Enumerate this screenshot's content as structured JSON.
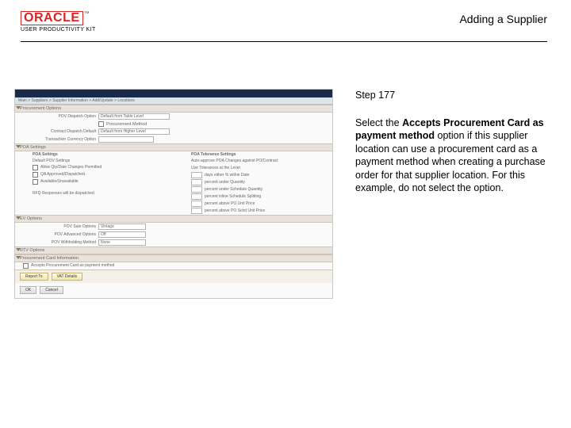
{
  "header": {
    "logo_main": "ORACLE",
    "logo_tm": "™",
    "logo_sub": "USER PRODUCTIVITY KIT",
    "title": "Adding a Supplier"
  },
  "right": {
    "step": "Step 177",
    "instr_pre": "Select the ",
    "instr_bold": "Accepts Procurement Card as payment method",
    "instr_post": " option if this supplier location can use a procurement card as a payment method when creating a purchase order for that supplier location. For this example, do not select the option."
  },
  "shot": {
    "bc": " Main  >  Suppliers  >  Supplier Information  >  Add/Update  >  Locations",
    "sect_proc": "Procurement Options",
    "row_dispatch_lbl": "POV Dispatch Option",
    "row_dispatch_val": "Default from Table Level",
    "row_procauto_cb": "□",
    "row_procauto_lbl": "Procurement Method",
    "row_contract_lbl": "Contract Dispatch Default",
    "row_contract_val": "Default from Higher Level",
    "row_curr_lbl": "Transaction Currency Option",
    "sect_poa": "POA Settings",
    "col1_head": "POA Settings",
    "col2_head": "POA Tolerance Settings",
    "col2_sub1": "Auto-approve POA Changes against PO/Contract",
    "col2_sub2": "Use Tolerances at the Level",
    "col1_sub": "Default POV Settings",
    "c1_a": "Allow Qty/Date Changes Permitted",
    "c1_b": "QA Approved/Dispatched",
    "c1_c": "Available/Unavailable",
    "c2_a": "days either % within Date",
    "c2_b": "percent under Quantity",
    "c2_c": "percent under Schedule Quantity",
    "c2_d": "percent inline Schedule Splitting",
    "c2_e": "percent above PO Unit Price",
    "c2_f": "percent above PO Schd Unit Price",
    "c1_d": "RFQ Responses will be dispatched",
    "sect_ev": "EV Options",
    "ev_a_lbl": "POV Sale Options",
    "ev_a_val": "Vintage",
    "ev_b_lbl": "POV Advanced Options",
    "ev_b_val": "Off",
    "ev_c_lbl": "POV Withholding Method",
    "ev_c_val": "None",
    "sect_rtv": "RTV Options",
    "sect_pcard": "Procurement Card Information",
    "pcard_opt": "Accepts Procurement Card as payment method",
    "btn_report": "Report To",
    "btn_vat": "VAT Details",
    "btn_ok": "OK",
    "btn_cancel": "Cancel"
  }
}
